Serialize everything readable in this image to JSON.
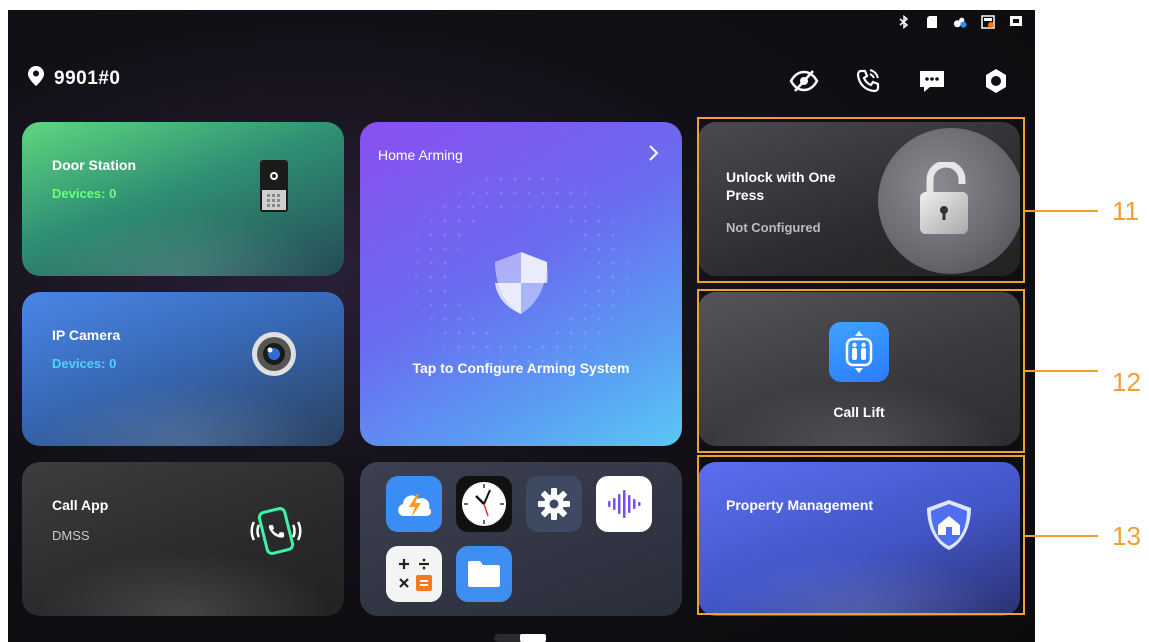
{
  "location": {
    "name": "9901#0",
    "icon": "location-pin-icon"
  },
  "status_icons": [
    "bluetooth-icon",
    "sd-card-icon",
    "cloud-user-icon",
    "device-alert-icon",
    "network-icon"
  ],
  "top_actions": [
    {
      "name": "privacy-hidden-icon"
    },
    {
      "name": "call-forward-icon"
    },
    {
      "name": "message-icon"
    },
    {
      "name": "settings-icon"
    }
  ],
  "door_station": {
    "title": "Door Station",
    "devices": "Devices: 0",
    "accent": "#6cff7a"
  },
  "ip_camera": {
    "title": "IP Camera",
    "devices": "Devices: 0",
    "accent": "#4fd0ff"
  },
  "call_app": {
    "title": "Call App",
    "subtitle": "DMSS"
  },
  "home_arming": {
    "title": "Home Arming",
    "action": "Tap to Configure Arming System"
  },
  "apps": [
    "dmss-cloud-app-icon",
    "clock-app-icon",
    "settings-app-icon",
    "voice-recorder-app-icon",
    "calculator-app-icon",
    "files-app-icon"
  ],
  "unlock": {
    "title": "Unlock with One Press",
    "status": "Not Configured"
  },
  "call_lift": {
    "label": "Call Lift"
  },
  "property": {
    "title": "Property Management"
  },
  "callouts": [
    "11",
    "12",
    "13"
  ],
  "colors": {
    "callout": "#f0a030"
  }
}
